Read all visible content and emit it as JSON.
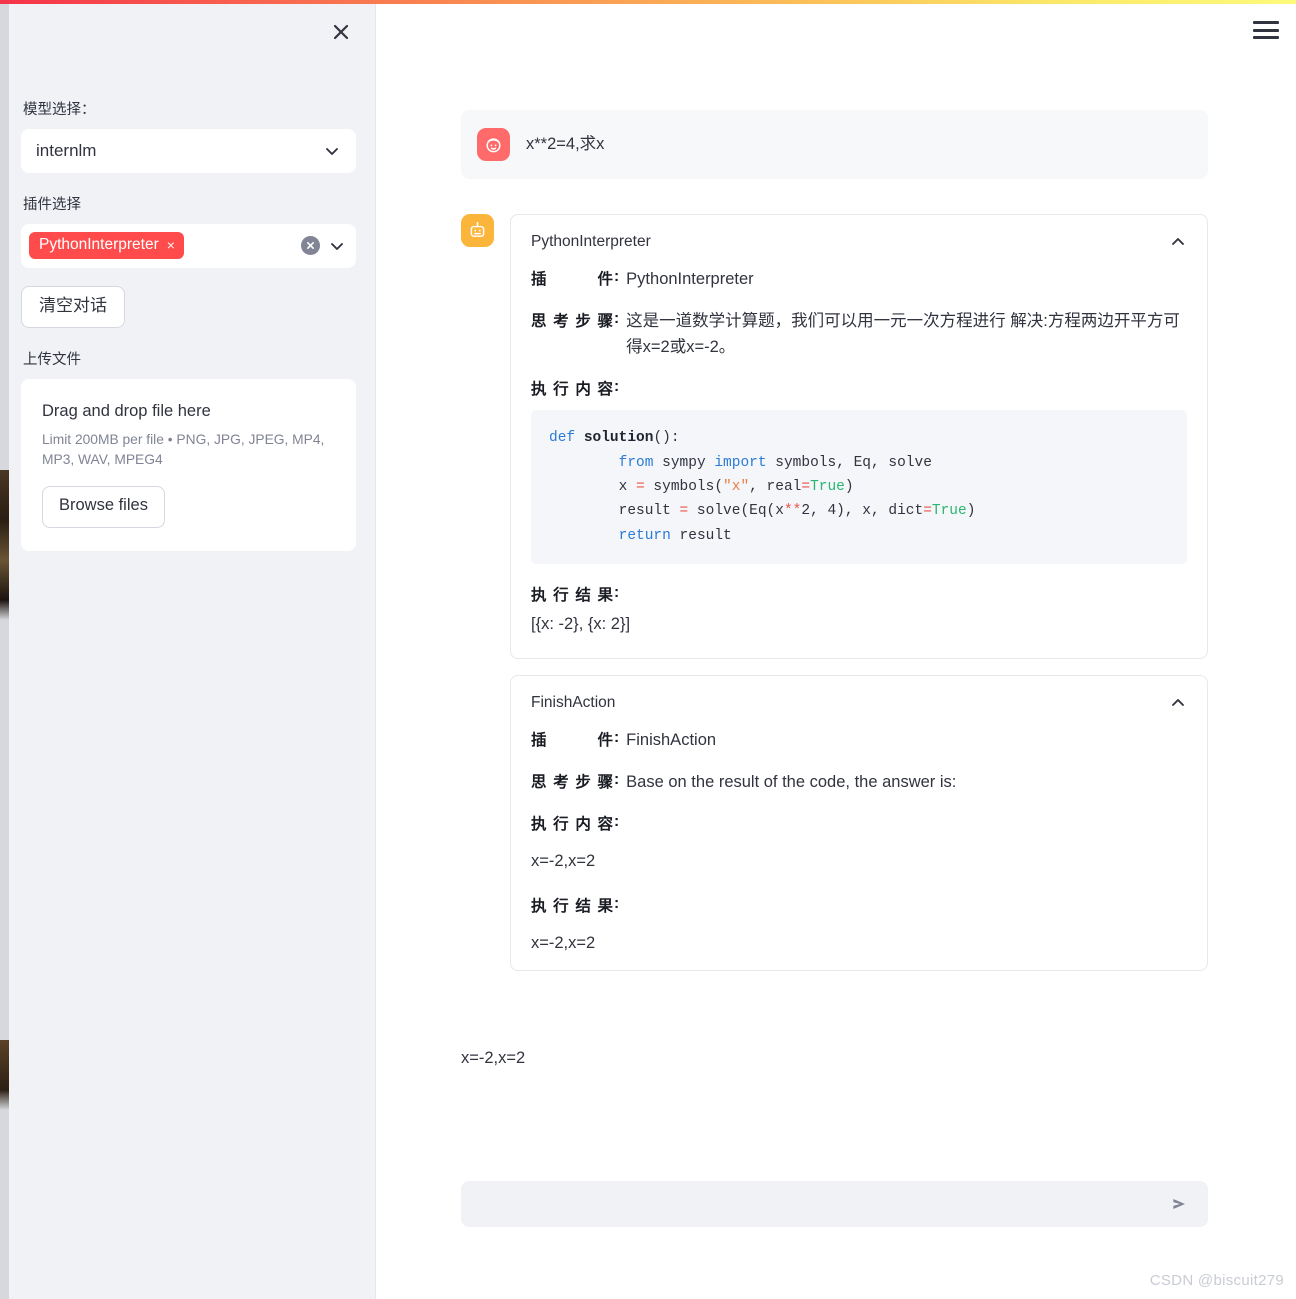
{
  "window": {
    "watermark": "CSDN @biscuit279"
  },
  "theme": {
    "accent_red": "#ff4b4b",
    "sidebar_bg": "#f0f2f6",
    "user_avatar_bg": "#ff6b6b",
    "bot_avatar_bg": "#fcb53b",
    "code_bg": "#f5f6f9",
    "top_bar_gradient_from": "#f5334a",
    "top_bar_gradient_to": "#fdfa7a"
  },
  "sidebar": {
    "close_icon": "close-icon",
    "model_label": "模型选择：",
    "model_value": "internlm",
    "plugin_label": "插件选择",
    "plugin_tags": [
      {
        "label": "PythonInterpreter",
        "remove": "×"
      }
    ],
    "plugin_clear_icon": "clear-circle-icon",
    "plugin_chevron_icon": "chevron-down-icon",
    "clear_chat_button": "清空对话",
    "upload_label": "上传文件",
    "uploader": {
      "title": "Drag and drop file here",
      "limits": "Limit 200MB per file • PNG, JPG, JPEG, MP4, MP3, WAV, MPEG4",
      "browse_button": "Browse files"
    }
  },
  "main": {
    "menu_icon": "hamburger-menu-icon",
    "user_message": {
      "avatar_icon": "user-face-icon",
      "text": "x**2=4,求x"
    },
    "assistant": {
      "avatar_icon": "robot-icon",
      "cards": [
        {
          "title": "PythonInterpreter",
          "collapse_icon": "chevron-up-icon",
          "plugin_key": "插件",
          "plugin_value": "PythonInterpreter",
          "thought_key": "思考步骤",
          "thought_value": "这是一道数学计算题，我们可以用一元一次方程进行 解决:方程两边开平方可得x=2或x=-2。",
          "action_key": "执行内容",
          "code_lines": [
            {
              "tokens": [
                {
                  "t": "def ",
                  "c": "tok-kw"
                },
                {
                  "t": "solution",
                  "c": "tok-fn"
                },
                {
                  "t": "():",
                  "c": "tok-punct"
                }
              ]
            },
            {
              "tokens": [
                {
                  "t": "        ",
                  "c": "tok-punct"
                },
                {
                  "t": "from ",
                  "c": "tok-kw"
                },
                {
                  "t": "sympy ",
                  "c": "tok-punct"
                },
                {
                  "t": "import ",
                  "c": "tok-kw"
                },
                {
                  "t": "symbols, Eq, solve",
                  "c": "tok-punct"
                }
              ]
            },
            {
              "tokens": [
                {
                  "t": "        x ",
                  "c": "tok-punct"
                },
                {
                  "t": "=",
                  "c": "tok-op"
                },
                {
                  "t": " symbols(",
                  "c": "tok-punct"
                },
                {
                  "t": "\"x\"",
                  "c": "tok-str"
                },
                {
                  "t": ", real",
                  "c": "tok-punct"
                },
                {
                  "t": "=",
                  "c": "tok-op"
                },
                {
                  "t": "True",
                  "c": "tok-bool"
                },
                {
                  "t": ")",
                  "c": "tok-punct"
                }
              ]
            },
            {
              "tokens": [
                {
                  "t": "        result ",
                  "c": "tok-punct"
                },
                {
                  "t": "=",
                  "c": "tok-op"
                },
                {
                  "t": " solve(Eq(x",
                  "c": "tok-punct"
                },
                {
                  "t": "**",
                  "c": "tok-op"
                },
                {
                  "t": "2",
                  "c": "tok-num"
                },
                {
                  "t": ", ",
                  "c": "tok-punct"
                },
                {
                  "t": "4",
                  "c": "tok-num"
                },
                {
                  "t": "), x, dict",
                  "c": "tok-punct"
                },
                {
                  "t": "=",
                  "c": "tok-op"
                },
                {
                  "t": "True",
                  "c": "tok-bool"
                },
                {
                  "t": ")",
                  "c": "tok-punct"
                }
              ]
            },
            {
              "tokens": [
                {
                  "t": "        ",
                  "c": "tok-punct"
                },
                {
                  "t": "return ",
                  "c": "tok-kw"
                },
                {
                  "t": "result",
                  "c": "tok-punct"
                }
              ]
            }
          ],
          "result_key": "执行结果",
          "result_value": "[{x: -2}, {x: 2}]"
        },
        {
          "title": "FinishAction",
          "collapse_icon": "chevron-up-icon",
          "plugin_key": "插件",
          "plugin_value": "FinishAction",
          "thought_key": "思考步骤",
          "thought_value": "Base on the result of the code, the answer is:",
          "action_key": "执行内容",
          "action_value": "x=-2,x=2",
          "result_key": "执行结果",
          "result_value": "x=-2,x=2"
        }
      ],
      "final_answer": "x=-2,x=2"
    },
    "chat_input": {
      "value": "",
      "placeholder": "",
      "send_icon": "send-arrow-icon"
    }
  }
}
